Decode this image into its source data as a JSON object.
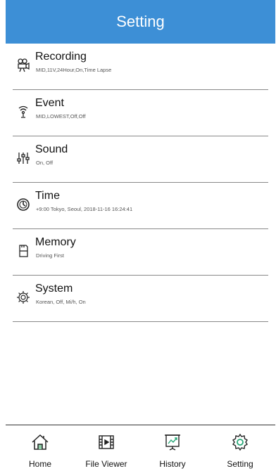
{
  "header": {
    "title": "Setting"
  },
  "settings": [
    {
      "title": "Recording",
      "summary": "MID,11V,24Hour,On,Time Lapse",
      "icon": "video-camera-icon"
    },
    {
      "title": "Event",
      "summary": "MID,LOWEST,Off,Off",
      "icon": "event-sensor-icon"
    },
    {
      "title": "Sound",
      "summary": "On, Off",
      "icon": "sound-sliders-icon"
    },
    {
      "title": "Time",
      "summary": "+9:00 Tokyo, Seoul, 2018-11-16 16:24:41",
      "icon": "clock-icon"
    },
    {
      "title": "Memory",
      "summary": "Driving First",
      "icon": "memory-card-icon"
    },
    {
      "title": "System",
      "summary": "Korean, Off, Mi/h, On",
      "icon": "system-gear-icon"
    }
  ],
  "tabs": [
    {
      "label": "Home",
      "icon": "home-icon"
    },
    {
      "label": "File Viewer",
      "icon": "film-icon"
    },
    {
      "label": "History",
      "icon": "chart-board-icon"
    },
    {
      "label": "Setting",
      "icon": "gear-icon"
    }
  ],
  "colors": {
    "header": "#3d8fd6",
    "accent": "#28a878"
  }
}
